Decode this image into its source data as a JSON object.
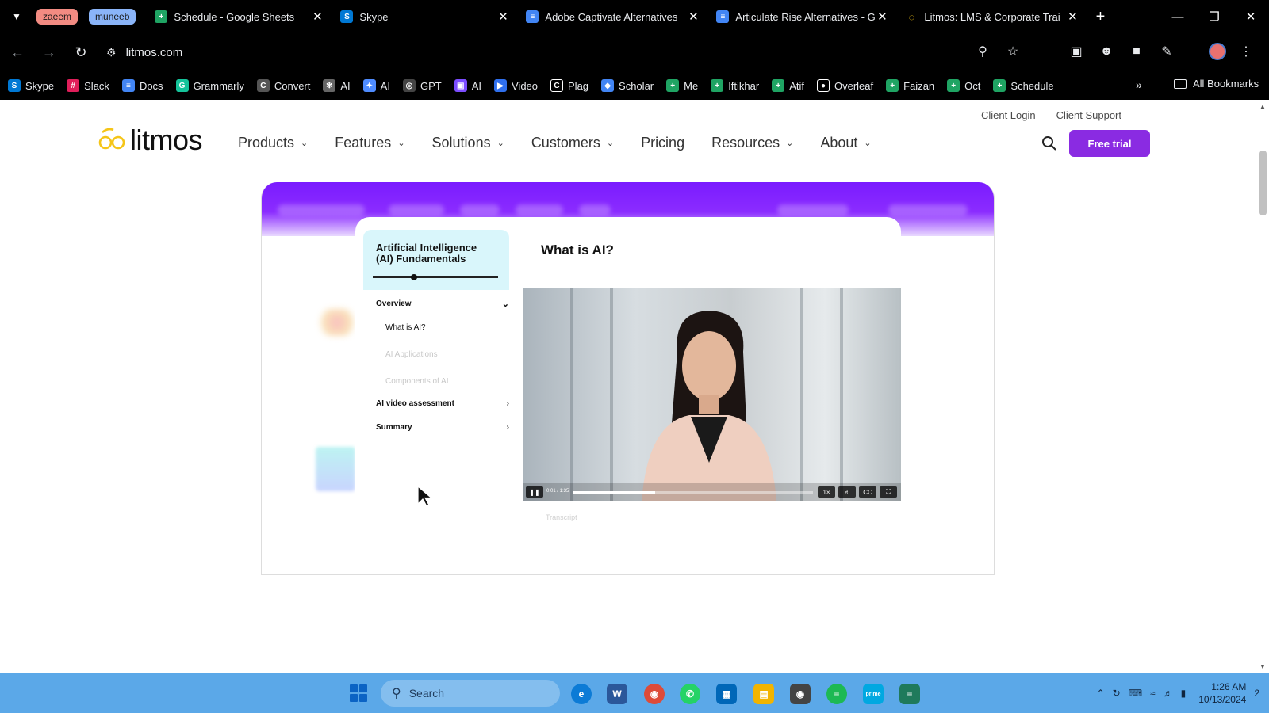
{
  "browser": {
    "tab_groups": [
      {
        "label": "zaeem",
        "color": "#f28b82"
      },
      {
        "label": "muneeb",
        "color": "#8ab4f8"
      }
    ],
    "tabs": [
      {
        "title": "Schedule - Google Sheets",
        "icon": "google-sheets-icon",
        "color": "#1fa463"
      },
      {
        "title": "Skype",
        "icon": "skype-icon",
        "color": "#0078d4"
      },
      {
        "title": "Adobe Captivate Alternatives",
        "icon": "google-docs-icon",
        "color": "#4285f4"
      },
      {
        "title": "Articulate Rise Alternatives - G",
        "icon": "google-docs-icon",
        "color": "#4285f4"
      },
      {
        "title": "Litmos: LMS & Corporate Trai",
        "icon": "litmos-icon",
        "color": "#f5c518"
      }
    ],
    "new_tab_label": "+",
    "url": "litmos.com",
    "bookmarks": [
      {
        "label": "Skype",
        "icon": "skype-icon",
        "color": "#0078d4"
      },
      {
        "label": "Slack",
        "icon": "slack-icon",
        "color": "#e01e5a"
      },
      {
        "label": "Docs",
        "icon": "google-docs-icon",
        "color": "#4285f4"
      },
      {
        "label": "Grammarly",
        "icon": "grammarly-icon",
        "color": "#15c39a"
      },
      {
        "label": "Convert",
        "icon": "convert-icon",
        "color": "#555555"
      },
      {
        "label": "AI",
        "icon": "ai-icon",
        "color": "#666666"
      },
      {
        "label": "AI",
        "icon": "sparkle-icon",
        "color": "#4f8cff"
      },
      {
        "label": "GPT",
        "icon": "openai-icon",
        "color": "#444444"
      },
      {
        "label": "AI",
        "icon": "ai-purple-icon",
        "color": "#7c4dff"
      },
      {
        "label": "Video",
        "icon": "video-icon",
        "color": "#2f6fed"
      },
      {
        "label": "Plag",
        "icon": "plag-icon",
        "color": "#ffffff"
      },
      {
        "label": "Scholar",
        "icon": "scholar-icon",
        "color": "#4285f4"
      },
      {
        "label": "Me",
        "icon": "google-sheets-icon",
        "color": "#1fa463"
      },
      {
        "label": "Iftikhar",
        "icon": "google-sheets-icon",
        "color": "#1fa463"
      },
      {
        "label": "Atif",
        "icon": "google-sheets-icon",
        "color": "#1fa463"
      },
      {
        "label": "Overleaf",
        "icon": "overleaf-icon",
        "color": "#ffffff"
      },
      {
        "label": "Faizan",
        "icon": "google-sheets-icon",
        "color": "#1fa463"
      },
      {
        "label": "Oct",
        "icon": "google-sheets-icon",
        "color": "#1fa463"
      },
      {
        "label": "Schedule",
        "icon": "google-sheets-icon",
        "color": "#1fa463"
      }
    ],
    "more_bookmarks": "»",
    "all_bookmarks": "All Bookmarks"
  },
  "site": {
    "logo": "litmos",
    "top_links": [
      "Client Login",
      "Client Support"
    ],
    "nav": [
      {
        "label": "Products",
        "dropdown": true
      },
      {
        "label": "Features",
        "dropdown": true
      },
      {
        "label": "Solutions",
        "dropdown": true
      },
      {
        "label": "Customers",
        "dropdown": true
      },
      {
        "label": "Pricing",
        "dropdown": false
      },
      {
        "label": "Resources",
        "dropdown": true
      },
      {
        "label": "About",
        "dropdown": true
      }
    ],
    "cta": "Free trial",
    "accent": "#8a2be2"
  },
  "course": {
    "title": "Artificial Intelligence (AI) Fundamentals",
    "progress": 0.32,
    "sections": [
      {
        "label": "Overview",
        "expanded": true
      },
      {
        "label": "AI video assessment",
        "expanded": false
      },
      {
        "label": "Summary",
        "expanded": false
      }
    ],
    "overview_items": [
      {
        "label": "What is AI?",
        "state": "current"
      },
      {
        "label": "AI Applications",
        "state": "dim"
      },
      {
        "label": "Components of AI",
        "state": "dim"
      }
    ],
    "lesson_title": "What is AI?",
    "video_time": "0:01 / 1:35",
    "video_progress": 0.34,
    "transcript_label": "Transcript"
  },
  "taskbar": {
    "search_placeholder": "Search",
    "time": "1:26 AM",
    "date": "10/13/2024",
    "notification_count": "2"
  }
}
